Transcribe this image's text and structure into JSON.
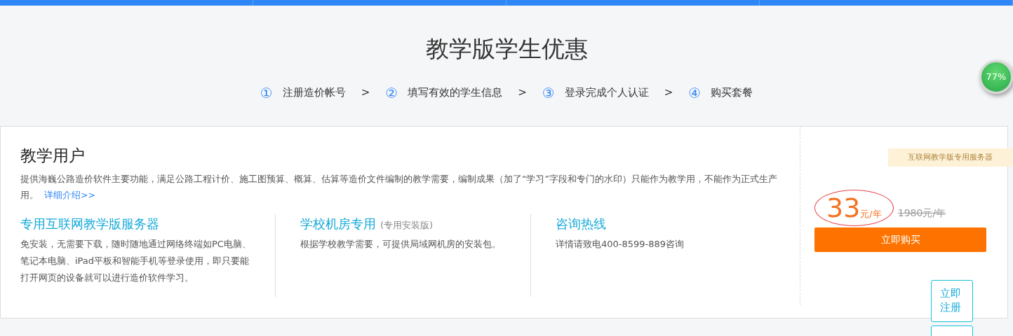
{
  "title": "教学版学生优惠",
  "steps": [
    {
      "number": "①",
      "label": "注册造价帐号",
      "separator": ">"
    },
    {
      "number": "②",
      "label": "填写有效的学生信息",
      "separator": ">"
    },
    {
      "number": "③",
      "label": "登录完成个人认证",
      "separator": ">"
    },
    {
      "number": "④",
      "label": "购买套餐"
    }
  ],
  "plan": {
    "heading": "教学用户",
    "description": "提供海巍公路造价软件主要功能，满足公路工程计价、施工图预算、概算、估算等造价文件编制的教学需要，编制成果（加了“学习”字段和专门的水印）只能作为教学用，不能作为正式生产用。",
    "details_link": "详细介绍>>",
    "features": [
      {
        "title": "专用互联网教学版服务器",
        "text": "免安装，无需要下载，随时随地通过网络终端如PC电脑、笔记本电脑、iPad平板和智能手机等登录使用，即只要能打开网页的设备就可以进行造价软件学习。"
      },
      {
        "title": "学校机房专用",
        "note": "(专用安装版)",
        "text": "根据学校教学需要，可提供局域网机房的安装包。"
      },
      {
        "title": "咨询热线",
        "text": "详情请致电400-8599-889咨询"
      }
    ],
    "ribbon": "互联网教学版专用服务器",
    "price": "33",
    "price_unit": "元/年",
    "old_price": "1980元/年",
    "buy_button": "立即购买"
  },
  "speed_ball": {
    "reading": "77%"
  },
  "side_buttons": [
    {
      "label": "立即注册"
    }
  ]
}
